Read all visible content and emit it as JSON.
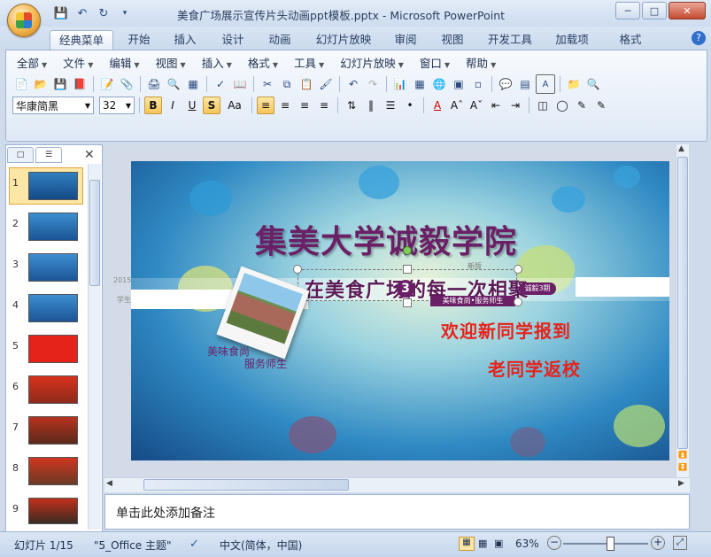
{
  "window": {
    "title": "美食广场展示宣传片头动画ppt模板.pptx - Microsoft PowerPoint",
    "minimize": "─",
    "maximize": "□",
    "close": "✕"
  },
  "quick_access": [
    "save-icon",
    "undo-icon",
    "redo-icon",
    "customize-icon"
  ],
  "ribbon_tabs": [
    "经典菜单",
    "开始",
    "插入",
    "设计",
    "动画",
    "幻灯片放映",
    "审阅",
    "视图",
    "开发工具",
    "加载项",
    "格式"
  ],
  "active_tab": "经典菜单",
  "help_label": "?",
  "menus": [
    "全部",
    "文件",
    "编辑",
    "视图",
    "插入",
    "格式",
    "工具",
    "幻灯片放映",
    "窗口",
    "帮助"
  ],
  "font": {
    "name": "华康简黑",
    "size": "32",
    "aa_label": "Aa",
    "bold": "B",
    "italic": "I",
    "underline": "U",
    "shadow": "S"
  },
  "thumbnails": {
    "numbers": [
      "1",
      "2",
      "3",
      "4",
      "5",
      "6",
      "7",
      "8",
      "9"
    ],
    "selected": 1
  },
  "slide": {
    "title": "集美大学诚毅学院",
    "overlay_text": "在美食广场的每一次相聚",
    "badge_number": "3",
    "subtitle_box": "美味食尚•服务师生",
    "side_label_left": "美味食尚",
    "side_label_right": "服务师生",
    "line1": "欢迎新同学报到",
    "line2": "老同学返校",
    "year": "2015",
    "small_left": "学生",
    "tag_right": "诚毅3期",
    "tag_top": "新版"
  },
  "notes_placeholder": "单击此处添加备注",
  "status": {
    "slide_info": "幻灯片 1/15",
    "theme": "\"5_Office 主题\"",
    "language": "中文(简体，中国)",
    "zoom": "63%",
    "zoom_fraction": 0.55
  },
  "colors": {
    "accent_title": "#6b1f66",
    "slide_red": "#e5231b"
  }
}
